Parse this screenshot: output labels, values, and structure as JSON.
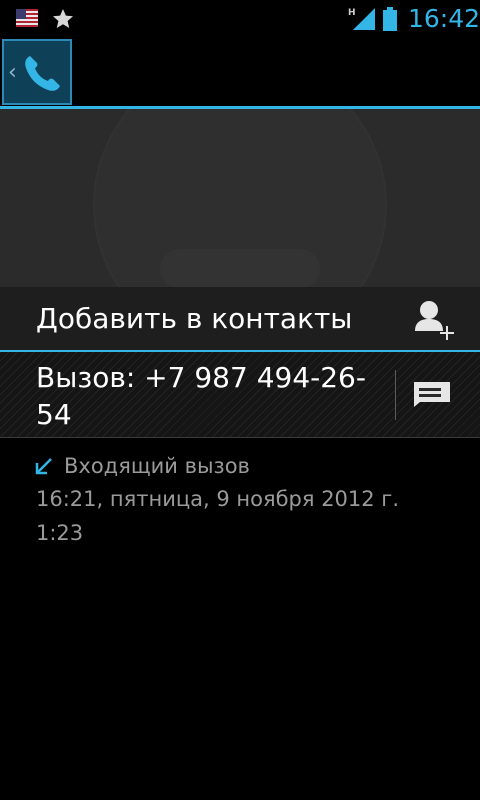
{
  "status_bar": {
    "time": "16:42",
    "network_type": "H",
    "icons": [
      "us-flag-icon",
      "star-icon",
      "signal-icon",
      "battery-icon"
    ]
  },
  "action_bar": {
    "up_icon": "phone-icon"
  },
  "add_contact": {
    "label": "Добавить в контакты",
    "icon": "add-person-icon"
  },
  "call": {
    "number_text": "Вызов: +7 987 494-26-54",
    "sms_icon": "message-icon"
  },
  "details": {
    "call_type": "Входящий вызов",
    "datetime": "16:21, пятница, 9 ноября 2012 г.",
    "duration": "1:23"
  },
  "colors": {
    "accent": "#33b5e5",
    "background": "#000000",
    "secondary_text": "#9a9a9a"
  }
}
